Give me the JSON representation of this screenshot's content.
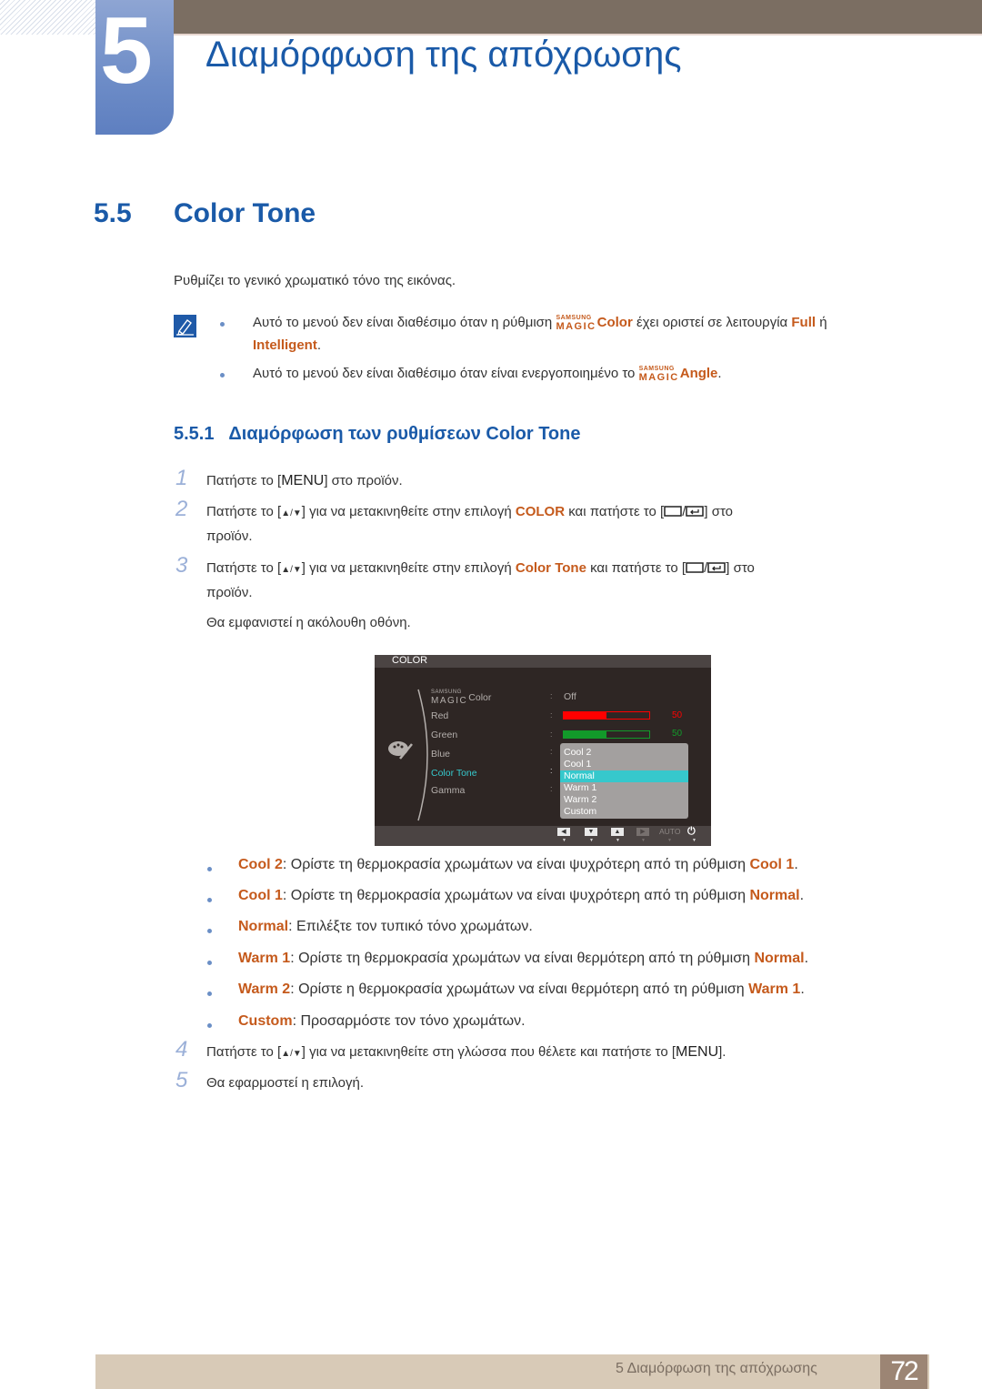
{
  "header": {
    "chapter_number": "5",
    "chapter_title": "Διαμόρφωση της απόχρωσης"
  },
  "section": {
    "number": "5.5",
    "title": "Color Tone",
    "intro": "Ρυθμίζει το γενικό χρωματικό τόνο της εικόνας."
  },
  "notes": {
    "icon": "note-pencil-icon",
    "items": [
      {
        "prefix": "Αυτό το μενού δεν είναι διαθέσιμο όταν η ρύθμιση ",
        "brand_top": "SAMSUNG",
        "brand_bottom": "MAGIC",
        "brand_word": "Color",
        "middle": " έχει οριστεί σε λειτουργία ",
        "hl1": "Full",
        "or": " ή",
        "hl2": "Intelligent",
        "suffix": "."
      },
      {
        "prefix": "Αυτό το μενού δεν είναι διαθέσιμο όταν είναι ενεργοποιημένο το ",
        "brand_top": "SAMSUNG",
        "brand_bottom": "MAGIC",
        "brand_word": "Angle",
        "suffix": "."
      }
    ]
  },
  "subsection": {
    "title": "5.5.1   Διαμόρφωση των ρυθμίσεων Color Tone"
  },
  "steps": [
    {
      "num": "1",
      "a": "Πατήστε το [",
      "key": "MENU",
      "b": "] στο προϊόν."
    },
    {
      "num": "2",
      "a": "Πατήστε το [",
      "arrows": "▲/▼",
      "b": "] για να μετακινηθείτε στην επιλογή ",
      "hl": "COLOR",
      "c": " και πατήστε το [",
      "d": "] στο",
      "e": "προϊόν."
    },
    {
      "num": "3",
      "a": "Πατήστε το [",
      "arrows": "▲/▼",
      "b": "] για να μετακινηθείτε στην επιλογή ",
      "hl": "Color Tone",
      "c": " και πατήστε το [",
      "d": "] στο",
      "e": "προϊόν.",
      "f": "Θα εμφανιστεί η ακόλουθη οθόνη."
    },
    {
      "num": "4",
      "a": "Πατήστε το [",
      "arrows": "▲/▼",
      "b": "] για να μετακινηθείτε στη γλώσσα που θέλετε και πατήστε το [",
      "key": "MENU",
      "c": "]."
    },
    {
      "num": "5",
      "a": "Θα εφαρμοστεί η επιλογή."
    }
  ],
  "osd": {
    "title": "COLOR",
    "rows": [
      {
        "brand_top": "SAMSUNG",
        "brand_bottom": "MAGIC",
        "label": "Color",
        "value": "Off"
      },
      {
        "label": "Red",
        "value": 50,
        "max": 100,
        "color": "#ff0000"
      },
      {
        "label": "Green",
        "value": 50,
        "max": 100,
        "color": "#129a2a"
      },
      {
        "label": "Blue"
      },
      {
        "label": "Color Tone",
        "active": true
      },
      {
        "label": "Gamma"
      }
    ],
    "dropdown": [
      "Cool 2",
      "Cool 1",
      "Normal",
      "Warm 1",
      "Warm 2",
      "Custom"
    ],
    "selected": "Normal",
    "footer": {
      "buttons": [
        "left-icon",
        "down-icon",
        "up-icon",
        "right-icon"
      ],
      "auto": "AUTO",
      "power": "power-icon"
    },
    "colors": {
      "active": "#36c8cc",
      "background": "#2e2624"
    }
  },
  "options": [
    {
      "name": "Cool 2",
      "text": ": Ορίστε τη θερμοκρασία χρωμάτων να είναι ψυχρότερη από τη ρύθμιση ",
      "ref": "Cool 1",
      "end": "."
    },
    {
      "name": "Cool 1",
      "text": ": Ορίστε τη θερμοκρασία χρωμάτων να είναι ψυχρότερη από τη ρύθμιση ",
      "ref": "Normal",
      "end": "."
    },
    {
      "name": "Normal",
      "text": ": Επιλέξτε τον τυπικό τόνο χρωμάτων.",
      "ref": "",
      "end": ""
    },
    {
      "name": "Warm 1",
      "text": ": Ορίστε τη θερμοκρασία χρωμάτων να είναι θερμότερη από τη ρύθμιση ",
      "ref": "Normal",
      "end": "."
    },
    {
      "name": "Warm 2",
      "text": ": Ορίστε η θερμοκρασία χρωμάτων να είναι θερμότερη από τη ρύθμιση ",
      "ref": "Warm 1",
      "end": "."
    },
    {
      "name": "Custom",
      "text": ": Προσαρμόστε τον τόνο χρωμάτων.",
      "ref": "",
      "end": ""
    }
  ],
  "footer": {
    "chapter_label": "5 Διαμόρφωση της απόχρωσης",
    "page_number": "72"
  },
  "colors": {
    "heading_blue": "#1a5aa8",
    "highlight_orange": "#c55a1c",
    "top_bar": "#7b6e62",
    "footer_bar": "#d8cab7",
    "page_box": "#9c8574"
  }
}
